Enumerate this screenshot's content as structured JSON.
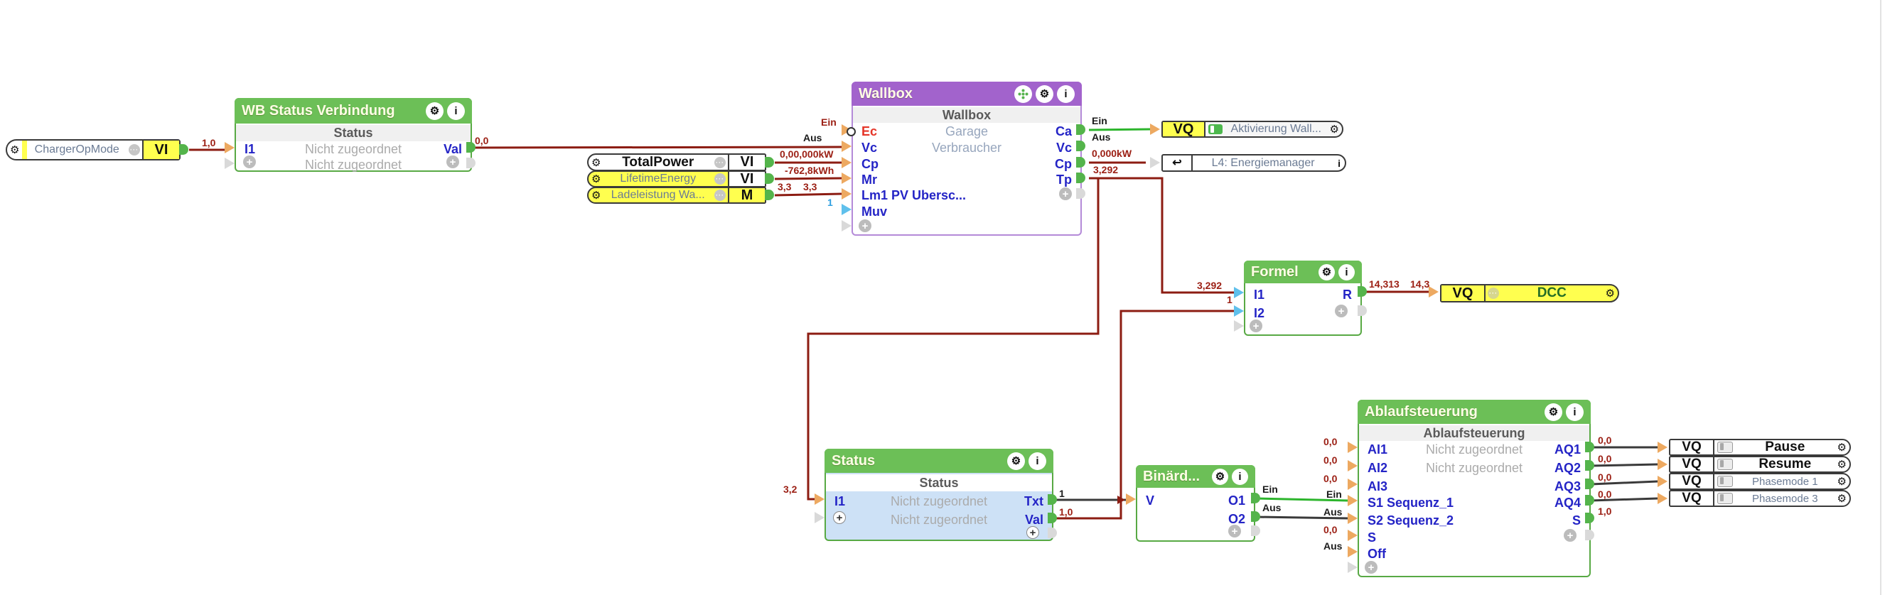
{
  "icons": {
    "gear": "⚙",
    "info": "i",
    "plus": "+",
    "ellipsis": "···",
    "return": "↩"
  },
  "blocks": {
    "wb_status": {
      "title": "WB Status Verbindung",
      "subtitle": "Status",
      "input1": "I1",
      "row1_center": "Nicht zugeordnet",
      "output1": "Val",
      "row2_center": "Nicht zugeordnet"
    },
    "wallbox": {
      "title": "Wallbox",
      "subtitle": "Wallbox",
      "desc1": "Garage",
      "desc2": "Verbraucher",
      "input1": "Ec",
      "input2": "Vc",
      "input3": "Cp",
      "input4": "Mr",
      "input5": "Lm1 PV Ubersc...",
      "input6": "Muv",
      "output1": "Ca",
      "output2": "Vc",
      "output3": "Cp",
      "output4": "Tp"
    },
    "formel": {
      "title": "Formel",
      "input1": "I1",
      "input2": "I2",
      "output1": "R"
    },
    "status": {
      "title": "Status",
      "subtitle": "Status",
      "input1": "I1",
      "row1_center": "Nicht zugeordnet",
      "row2_center": "Nicht zugeordnet",
      "output1": "Txt",
      "output2": "Val"
    },
    "binaerdekoder": {
      "title": "Binärd...",
      "input1": "V",
      "output1": "O1",
      "output2": "O2"
    },
    "ablaufsteuerung": {
      "title": "Ablaufsteuerung",
      "subtitle": "Ablaufsteuerung",
      "input1": "AI1",
      "input2": "AI2",
      "input3": "AI3",
      "input4": "S1 Sequenz_1",
      "input5": "S2 Sequenz_2",
      "input6": "S",
      "input7": "Off",
      "row1_center": "Nicht zugeordnet",
      "row2_center": "Nicht zugeordnet",
      "output1": "AQ1",
      "output2": "AQ2",
      "output3": "AQ3",
      "output4": "AQ4",
      "output5": "S"
    }
  },
  "pills": {
    "charger_op_mode": {
      "label": "ChargerOpMode",
      "badge": "VI"
    },
    "total_power": {
      "label": "TotalPower",
      "badge": "VI"
    },
    "lifetime_energy": {
      "label": "LifetimeEnergy",
      "badge": "VI"
    },
    "ladeleistung": {
      "label": "Ladeleistung Wa...",
      "badge": "M"
    },
    "aktivierung_wallbox": {
      "badge": "VQ",
      "label": "Aktivierung Wall..."
    },
    "l4_energiemanager": {
      "label": "L4: Energiemanager"
    },
    "dcc": {
      "badge": "VQ",
      "label": "DCC"
    },
    "pause": {
      "badge": "VQ",
      "label": "Pause"
    },
    "resume": {
      "badge": "VQ",
      "label": "Resume"
    },
    "phasemode_1": {
      "badge": "VQ",
      "label": "Phasemode 1"
    },
    "phasemode_3": {
      "badge": "VQ",
      "label": "Phasemode 3"
    }
  },
  "wire_values": {
    "charger": "1,0",
    "wb_val": "0,0",
    "ec_in": "Ein",
    "vc_in": "Aus",
    "cp_in": "0,00,000kW",
    "mr_in": "-762,8kWh",
    "lm_src": "3,3",
    "lm_in": "3,3",
    "muv_in": "1",
    "ca_out": "Ein",
    "vc_out": "Aus",
    "cp_out": "0,000kW",
    "tp_out": "3,292",
    "formel_i1": "3,292",
    "formel_i2": "1",
    "r_out": "14,313",
    "r_in": "14,3",
    "status_i1": "3,2",
    "txt_out": "1",
    "val_out": "1,0",
    "o1_out": "Ein",
    "o2_out": "Aus",
    "ai1_in": "0,0",
    "ai2_in": "0,0",
    "ai3_in": "0,0",
    "s1_in": "Ein",
    "s2_in": "Aus",
    "s_in": "0,0",
    "off_in": "Aus",
    "aq1_out": "0,0",
    "aq2_out": "0,0",
    "aq3_out": "0,0",
    "aq4_out": "0,0",
    "s_out": "1,0"
  }
}
